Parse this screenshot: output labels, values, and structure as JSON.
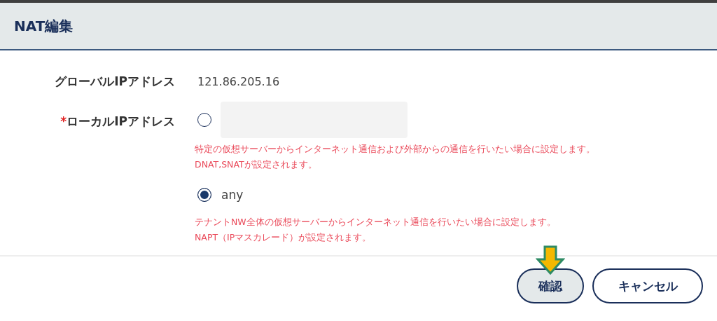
{
  "dialog": {
    "title": "NAT編集"
  },
  "fields": [
    {
      "label": "グローバルIPアドレス",
      "value": "121.86.205.16"
    },
    {
      "label": "ローカルIPアドレス",
      "required_mark": "*"
    }
  ],
  "options": [
    {
      "kind": "input",
      "selected": false,
      "help": [
        "特定の仮想サーバーからインターネット通信および外部からの通信を行いたい場合に設定します。",
        "DNAT,SNATが設定されます。"
      ]
    },
    {
      "kind": "text",
      "label": "any",
      "selected": true,
      "help": [
        "テナントNW全体の仮想サーバーからインターネット通信を行いたい場合に設定します。",
        "NAPT（IPマスカレード）が設定されます。"
      ]
    }
  ],
  "buttons": [
    {
      "label": "確認",
      "kind": "primary"
    },
    {
      "label": "キャンセル",
      "kind": "secondary"
    }
  ]
}
